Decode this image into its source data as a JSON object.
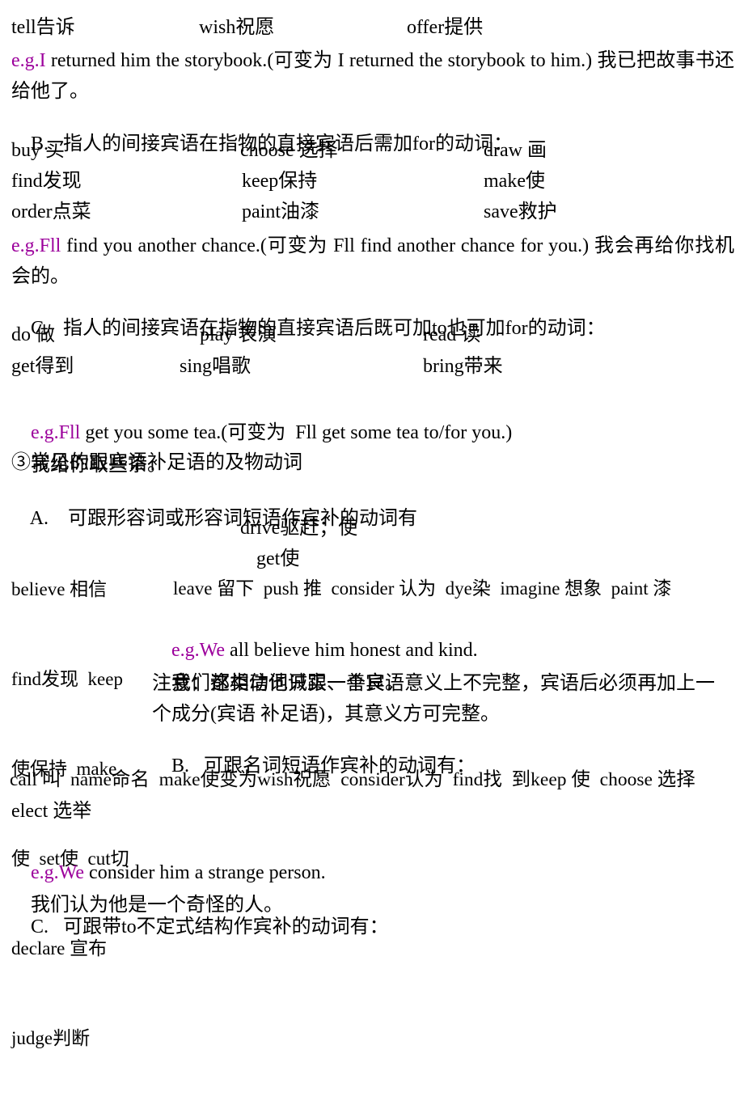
{
  "document": {
    "language": "zh-CN + en",
    "accent_color": "#9C009C",
    "text_color": "#000000",
    "background_color": "#FFFFFF"
  },
  "section_a_tail": {
    "verb_row": {
      "col1": "tell告诉",
      "col2": "wish祝愿",
      "col3": "offer提供"
    },
    "example": {
      "tag": "e.g.",
      "sentence": "I returned him the storybook.",
      "note": "(可变为  I returned the storybook to him.)",
      "translation": "我已把故事书还给他了。"
    }
  },
  "section_b": {
    "heading_label": "B.",
    "heading_text": "指人的间接宾语在指物的直接宾语后需加for的动词：",
    "verb_rows": [
      {
        "col1": "buy 买",
        "col2": "choose 选择",
        "col3": "draw 画"
      },
      {
        "col1": "find发现",
        "col2": "keep保持",
        "col3": "make使"
      },
      {
        "col1": "order点菜",
        "col2": "paint油漆",
        "col3": "save救护"
      }
    ],
    "example": {
      "tag": "e.g.",
      "sentence": "Fll find you another chance.",
      "note": "(可变为  Fll find another chance for you.)",
      "translation": "我会再给你找机会的。"
    }
  },
  "section_c": {
    "heading_label": "C.",
    "heading_text": "指人的间接宾语在指物的直接宾语后既可加to也可加for的动词：",
    "verb_rows": [
      {
        "col1": "do 做",
        "col2": "play 表演",
        "col3": "read 读"
      },
      {
        "col1": "get得到",
        "col2": "sing唱歌",
        "col3": "bring带来"
      }
    ],
    "example": {
      "tag": "e.g.",
      "sentence": "Fll get you some tea.",
      "note": "(可变为  Fll get some tea to/for you.)",
      "translation": "我给你取些茶。"
    }
  },
  "section_three": {
    "title": "③常见的跟宾语补足语的及物动词",
    "sub_a": {
      "label": "A.",
      "text": "可跟形容词或形容词短语作宾补的动词有"
    },
    "left_column_verbs": [
      "believe 相信",
      "find发现  keep",
      "使保持  make",
      "使  set使  cut切",
      "declare 宣布",
      "judge判断"
    ],
    "right_column_verbs": [
      "drive驱赶；使",
      "get使",
      "leave 留下  push 推  consider 认为  dye染  imagine 想象  paint 漆"
    ],
    "example": {
      "tag": "e.g.",
      "sentence": "We all believe him honest and kind.",
      "translation": "我们都相信他诚实、善良。"
    },
    "note": "注意：这类动词只跟一个宾语意义上不完整，宾语后必须再加上一个成分(宾语  补足语)，其意义方可完整。",
    "sub_b": {
      "label": "B.",
      "text": "可跟名词短语作宾补的动词有：",
      "verbs_line1": "call 叫  name命名  make使变为wish祝愿  consider认为  find找  到keep 使  choose 选择",
      "verbs_line2": "elect 选举",
      "example": {
        "tag": "e.g.",
        "sentence": "We consider him a strange person.",
        "translation": "我们认为他是一个奇怪的人。"
      }
    },
    "sub_c": {
      "label": "C.",
      "text": "可跟带to不定式结构作宾补的动词有："
    }
  }
}
